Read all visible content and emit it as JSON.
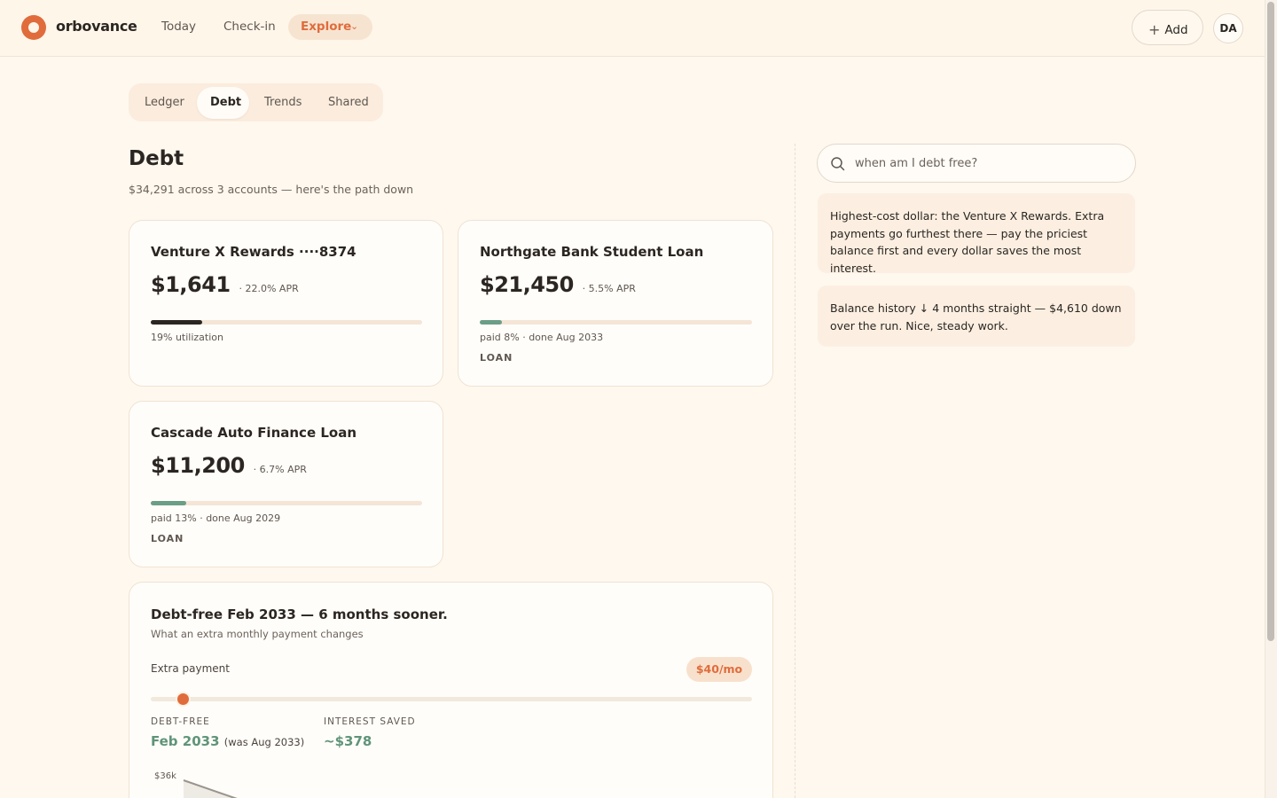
{
  "app": {
    "brand": "orbovance"
  },
  "topnav": {
    "today": "Today",
    "checkin": "Check-in",
    "explore": "Explore",
    "add": "Add",
    "avatar_initials": "DA"
  },
  "tabs": {
    "ledger": "Ledger",
    "debt": "Debt",
    "trends": "Trends",
    "shared": "Shared",
    "active": "Debt"
  },
  "page": {
    "title": "Debt",
    "subtitle": "$34,291 across 3 accounts — here's the path down"
  },
  "accounts": [
    {
      "name": "Venture X Rewards ····8374",
      "balance": "$1,641",
      "apr": "· 22.0% APR",
      "progress": 0.19,
      "meta": "19% utilization",
      "type": "",
      "bar_color": "#2b2622"
    },
    {
      "name": "Northgate Bank Student Loan",
      "balance": "$21,450",
      "apr": "· 5.5% APR",
      "progress": 0.08,
      "meta": "paid 8% · done Aug 2033",
      "type": "LOAN",
      "bar_color": "#6b9e86"
    },
    {
      "name": "Cascade Auto Finance Loan",
      "balance": "$11,200",
      "apr": "· 6.7% APR",
      "progress": 0.13,
      "meta": "paid 13% · done Aug 2029",
      "type": "LOAN",
      "bar_color": "#6b9e86"
    }
  ],
  "plan": {
    "title": "Debt-free Feb 2033 — 6 months sooner.",
    "subtitle": "What an extra monthly payment changes",
    "extra_label": "Extra payment",
    "extra_value": "$40/mo",
    "slider_fraction": 0.053,
    "debt_free_label": "DEBT-FREE",
    "debt_free_value": "Feb 2033",
    "debt_free_was": "(was Aug 2033)",
    "interest_label": "INTEREST SAVED",
    "interest_value": "~$378",
    "chart_top_tick": "$36k"
  },
  "search": {
    "placeholder": "when am I debt free?"
  },
  "insights": [
    "Highest-cost dollar: the Venture X Rewards. Extra payments go furthest there — pay the priciest balance first and every dollar saves the most interest.",
    "Balance history ↓ 4 months straight — $4,610 down over the run. Nice, steady work."
  ],
  "colors": {
    "accent": "#e06c3c",
    "positive": "#5f9478",
    "background": "#fff8ee"
  }
}
